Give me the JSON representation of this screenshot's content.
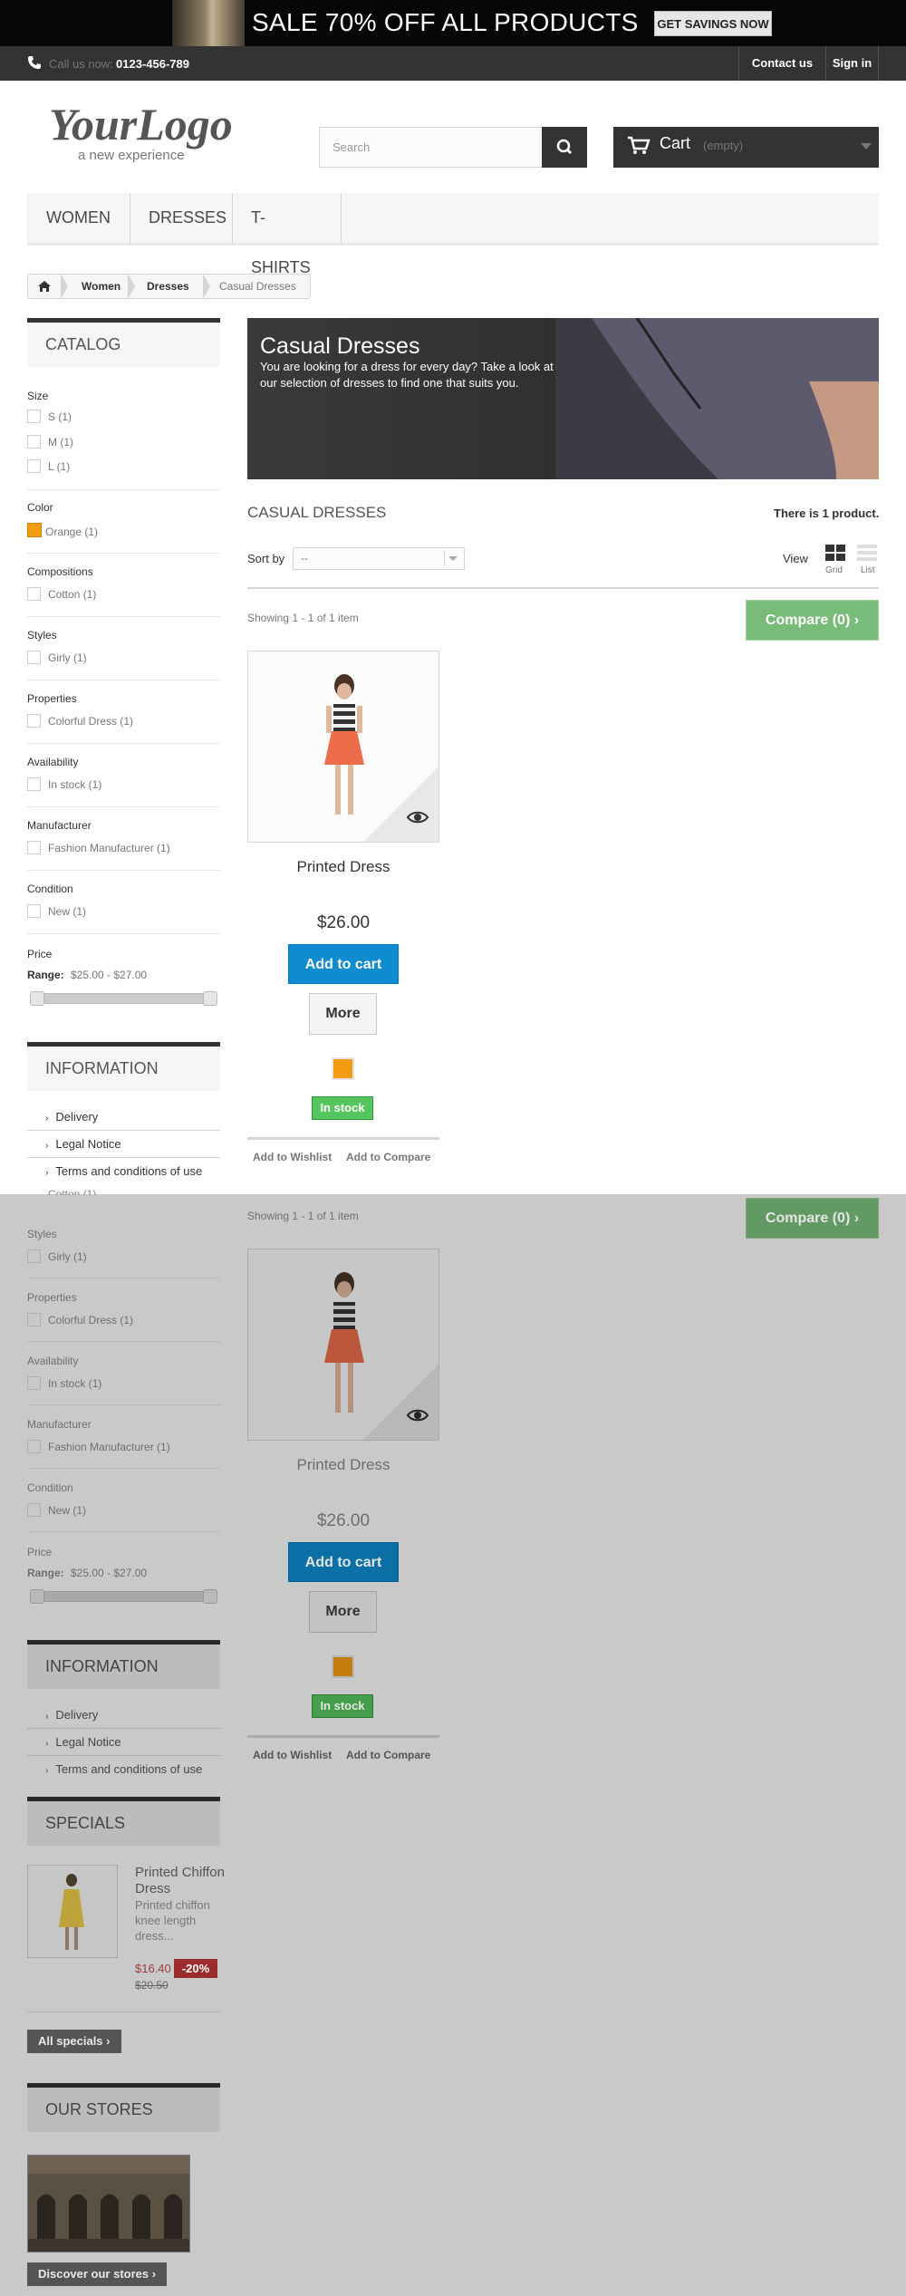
{
  "top_banner": {
    "text": "SALE 70% OFF ALL PRODUCTS",
    "button": "GET SAVINGS NOW"
  },
  "nav": {
    "call_label": "Call us now:",
    "phone": "0123-456-789",
    "contact": "Contact us",
    "signin": "Sign in"
  },
  "logo": {
    "line1": "YourLogo",
    "line2": "a new experience"
  },
  "search": {
    "placeholder": "Search"
  },
  "cart": {
    "label": "Cart",
    "status": "(empty)"
  },
  "menu": [
    "WOMEN",
    "DRESSES",
    "T-SHIRTS"
  ],
  "breadcrumb": [
    "Women",
    "Dresses",
    "Casual Dresses"
  ],
  "catalog": {
    "title": "CATALOG",
    "size": {
      "label": "Size",
      "items": [
        "S (1)",
        "M (1)",
        "L (1)"
      ]
    },
    "color": {
      "label": "Color",
      "items": [
        "Orange (1)"
      ],
      "swatch": "#f39c11"
    },
    "compositions": {
      "label": "Compositions",
      "items": [
        "Cotton (1)"
      ]
    },
    "styles": {
      "label": "Styles",
      "items": [
        "Girly (1)"
      ]
    },
    "properties": {
      "label": "Properties",
      "items": [
        "Colorful Dress (1)"
      ]
    },
    "availability": {
      "label": "Availability",
      "items": [
        "In stock (1)"
      ]
    },
    "manufacturer": {
      "label": "Manufacturer",
      "items": [
        "Fashion Manufacturer (1)"
      ]
    },
    "condition": {
      "label": "Condition",
      "items": [
        "New (1)"
      ]
    },
    "price": {
      "label": "Price",
      "range_label": "Range:",
      "range": "$25.00 - $27.00"
    }
  },
  "information": {
    "title": "INFORMATION",
    "items": [
      "Delivery",
      "Legal Notice",
      "Terms and conditions of use"
    ]
  },
  "category": {
    "title": "Casual Dresses",
    "description": "You are looking for a dress for every day? Take a look at our selection of dresses to find one that suits you.",
    "heading": "CASUAL DRESSES",
    "count": "There is 1 product."
  },
  "toolbar": {
    "sort_label": "Sort by",
    "sort_value": "--",
    "view_label": "View",
    "grid": "Grid",
    "list": "List",
    "showing": "Showing 1 - 1 of 1 item",
    "compare": "Compare (0)"
  },
  "product": {
    "name": "Printed Dress",
    "price": "$26.00",
    "add_to_cart": "Add to cart",
    "more": "More",
    "stock": "In stock",
    "wishlist": "Add to Wishlist",
    "add_compare": "Add to Compare"
  },
  "specials": {
    "title": "SPECIALS",
    "name": "Printed Chiffon Dress",
    "desc": "Printed chiffon knee length dress...",
    "price": "$16.40",
    "discount": "-20%",
    "old_price": "$20.50",
    "all": "All specials"
  },
  "stores": {
    "title": "OUR STORES",
    "button": "Discover our stores"
  },
  "colors": {
    "primary_blue": "#0e8ccf",
    "stock_green": "#55c65e",
    "compare_green": "#79bb79",
    "dark": "#333333"
  }
}
